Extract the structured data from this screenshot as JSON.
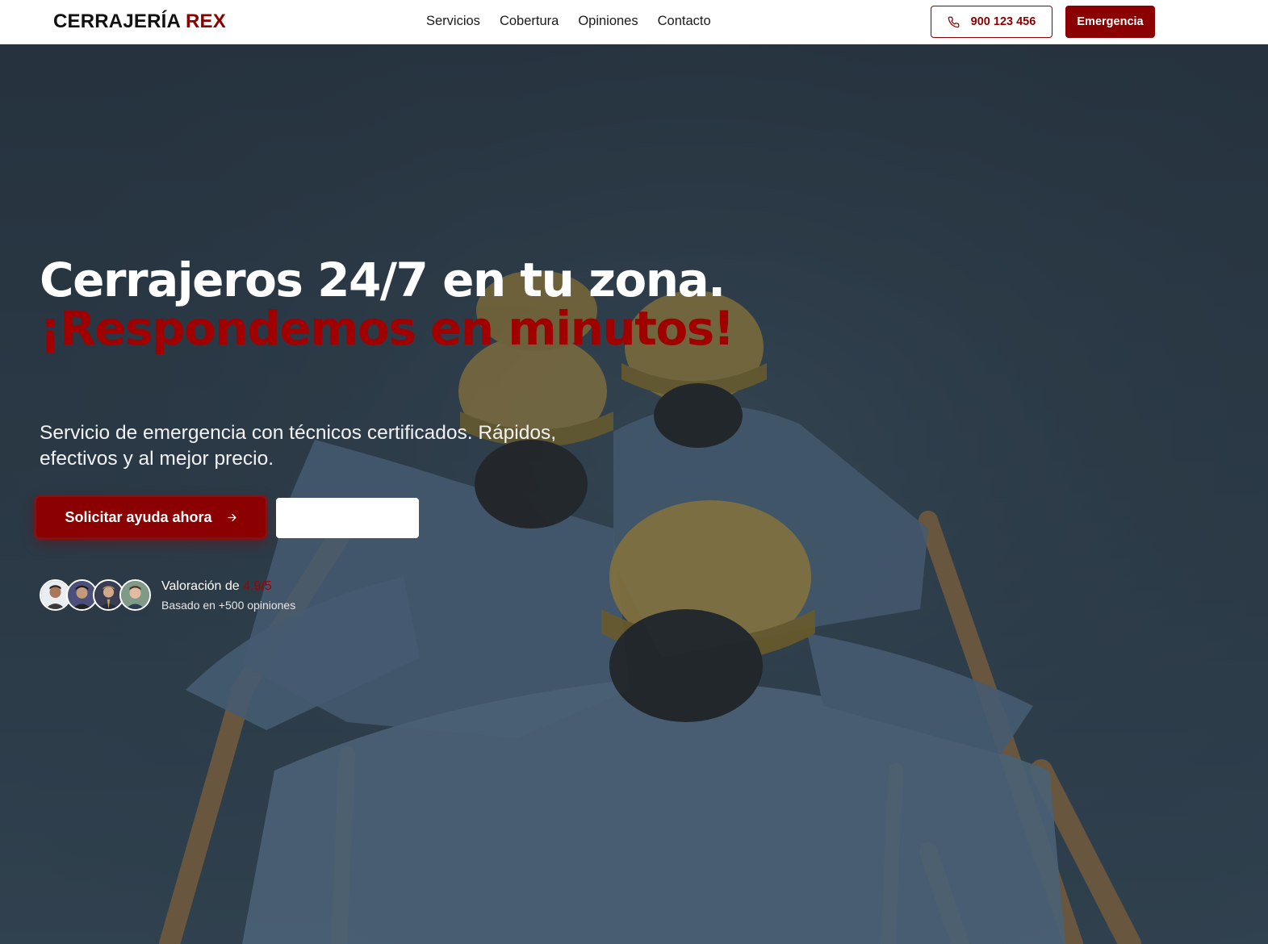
{
  "header": {
    "logo_text": "CERRAJERÍA",
    "logo_accent": "REX",
    "nav": [
      "Servicios",
      "Cobertura",
      "Opiniones",
      "Contacto"
    ],
    "phone_icon": "phone-icon",
    "phone_number": "900 123 456",
    "emergency_label": "Emergencia"
  },
  "hero": {
    "title_white": "Cerrajeros 24/7 en tu zona.",
    "title_red": "¡Respondemos en minutos!",
    "subtitle": "Servicio de emergencia con técnicos certificados. Rápidos, efectivos y al mejor precio.",
    "cta_primary": "Solicitar ayuda ahora",
    "cta_primary_icon": "arrow-right-icon",
    "cta_secondary": "",
    "rating_prefix": "Valoración de",
    "rating_score": "4.9/5",
    "rating_basis": "Basado en +500 opiniones"
  },
  "colors": {
    "brand": "#8b0000",
    "accent_text": "#a00000",
    "header_bg": "#ffffff",
    "hero_overlay": "#3a4854"
  }
}
